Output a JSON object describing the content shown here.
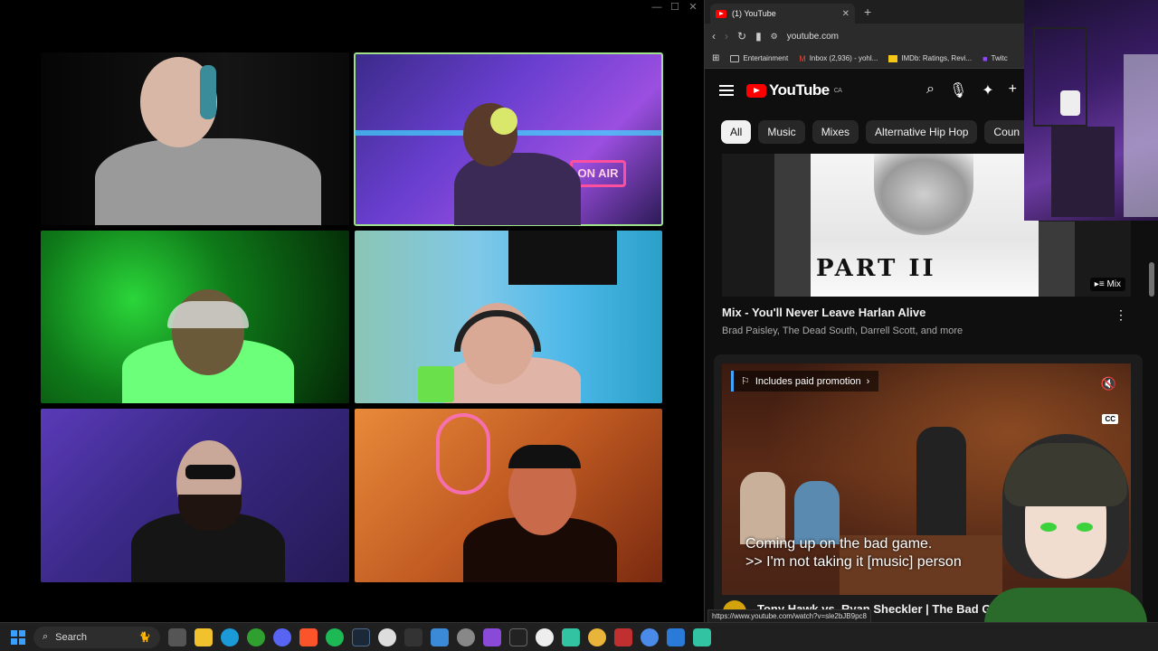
{
  "call": {
    "controls": [
      "—",
      "☐",
      "✕"
    ]
  },
  "browser": {
    "tab_title": "(1) YouTube",
    "tab_close": "✕",
    "new_tab": "+",
    "url": "youtube.com",
    "bookmarks": [
      "Entertainment",
      "Inbox (2,936) - yohl...",
      "IMDb: Ratings, Revi...",
      "Twitc"
    ],
    "status_url": "https://www.youtube.com/watch?v=sle2bJB9pc8"
  },
  "youtube": {
    "logo_text": "YouTube",
    "region": "CA",
    "chips": [
      "All",
      "Music",
      "Mixes",
      "Alternative Hip Hop",
      "Coun"
    ],
    "video1": {
      "title": "Mix - You'll Never Leave Harlan Alive",
      "subtitle": "Brad Paisley, The Dead South, Darrell Scott, and more",
      "thumbnail_text": "PART II",
      "badge": "Mix"
    },
    "ad": {
      "promo": "Includes paid promotion",
      "cc": "CC",
      "caption_line1": "Coming up on the bad game.",
      "caption_line2": ">> I'm not taking it [music] person"
    },
    "video2": {
      "title": "Tony Hawk vs. Ryan Sheckler | The Bad Game"
    }
  },
  "taskbar": {
    "search_label": "Search"
  }
}
